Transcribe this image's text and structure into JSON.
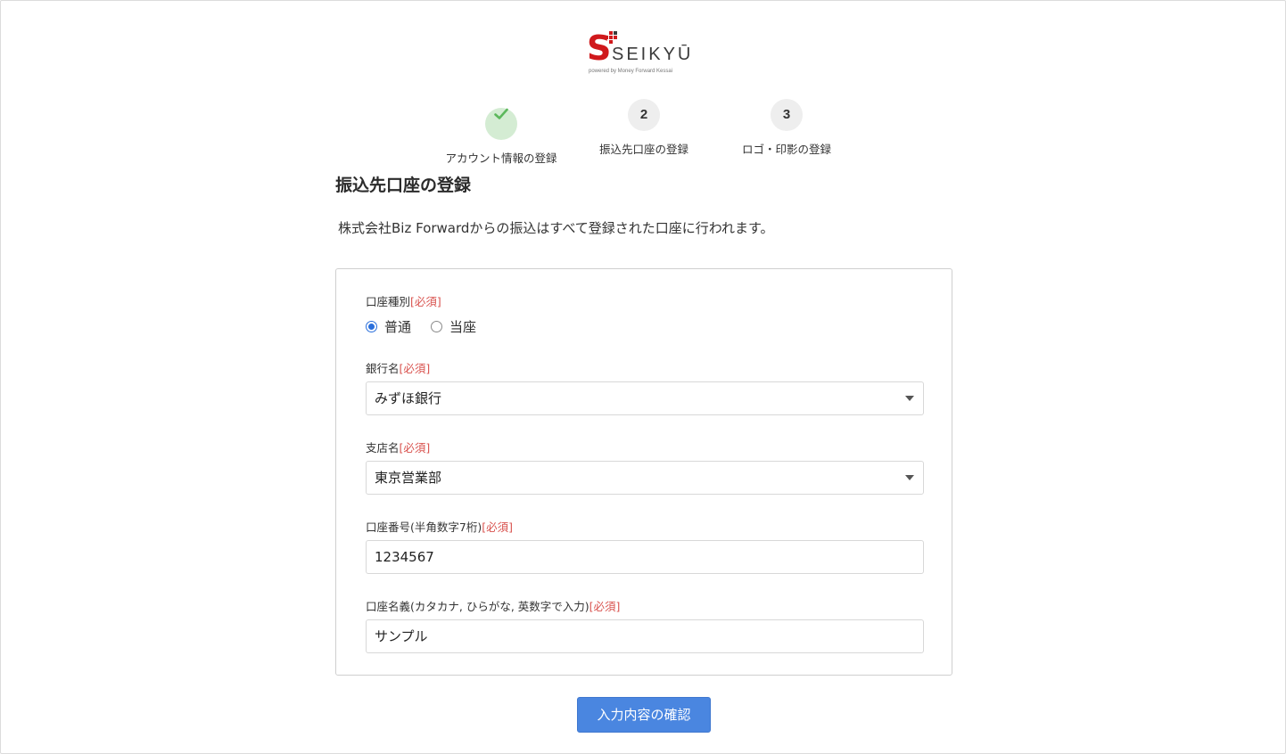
{
  "logo": {
    "mark": "S",
    "word": "SEIKYŪ",
    "sub": "powered by Money Forward Kessai"
  },
  "steps": [
    {
      "number": "1",
      "label": "アカウント情報の登録",
      "status": "done"
    },
    {
      "number": "2",
      "label": "振込先口座の登録",
      "status": "current"
    },
    {
      "number": "3",
      "label": "ロゴ・印影の登録",
      "status": "pending"
    }
  ],
  "page": {
    "title": "振込先口座の登録",
    "intro": "株式会社Biz Forwardからの振込はすべて登録された口座に行われます。"
  },
  "form": {
    "required_mark": "[必須]",
    "account_type": {
      "label": "口座種別",
      "options": [
        {
          "label": "普通",
          "selected": true
        },
        {
          "label": "当座",
          "selected": false
        }
      ]
    },
    "bank": {
      "label": "銀行名",
      "value": "みずほ銀行"
    },
    "branch": {
      "label": "支店名",
      "value": "東京営業部"
    },
    "account_number": {
      "label": "口座番号(半角数字7桁)",
      "value": "1234567"
    },
    "account_holder": {
      "label": "口座名義(カタカナ, ひらがな, 英数字で入力)",
      "value": "サンプル"
    }
  },
  "actions": {
    "confirm_label": "入力内容の確認"
  },
  "colors": {
    "brand_red": "#d0191c",
    "primary_button": "#4a86e0",
    "required": "#d9534f",
    "step_done": "#d4ecd3",
    "check": "#5cb85c"
  }
}
